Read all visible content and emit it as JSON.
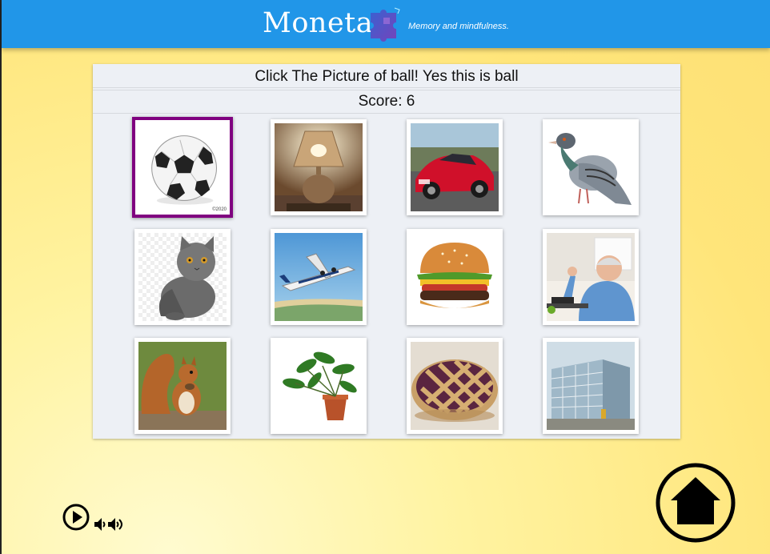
{
  "header": {
    "title": "Moneta",
    "tagline": "Memory and mindfulness.",
    "logo_icon": "puzzle-icon",
    "background_color": "#2196e8"
  },
  "game": {
    "prompt": "Click The Picture of ball! Yes this is ball",
    "score_text": "Score: 6",
    "selected_border_color": "#800080",
    "tiles": [
      {
        "name": "ball",
        "selected": true,
        "caption": "©2020"
      },
      {
        "name": "lamp",
        "selected": false
      },
      {
        "name": "car",
        "selected": false
      },
      {
        "name": "pigeon",
        "selected": false
      },
      {
        "name": "cat",
        "selected": false
      },
      {
        "name": "airplane",
        "selected": false
      },
      {
        "name": "burger",
        "selected": false
      },
      {
        "name": "man",
        "selected": false
      },
      {
        "name": "squirrel",
        "selected": false
      },
      {
        "name": "plant",
        "selected": false
      },
      {
        "name": "pie",
        "selected": false
      },
      {
        "name": "building",
        "selected": false
      }
    ]
  },
  "controls": {
    "play_icon": "play-circle-icon",
    "volume_down_icon": "volume-down-icon",
    "volume_up_icon": "volume-up-icon",
    "home_icon": "home-icon"
  }
}
